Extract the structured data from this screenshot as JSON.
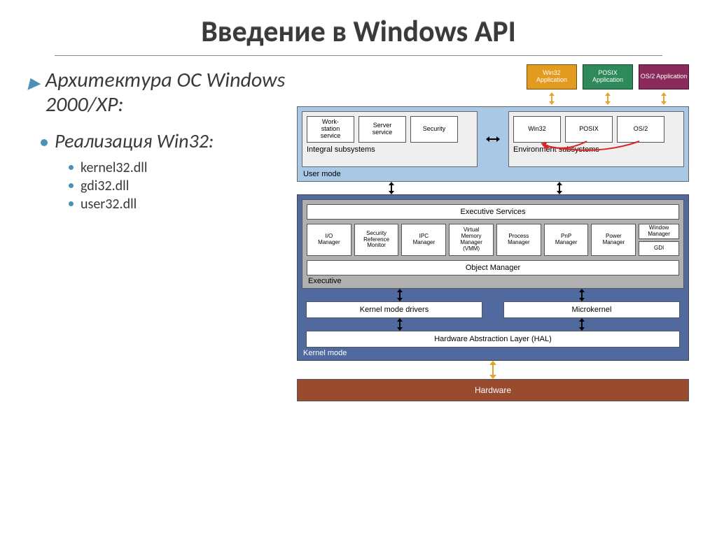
{
  "title": "Введение в Windows API",
  "bullets": {
    "lvl1": "Архитектура  ОС Windows 2000/XP:",
    "lvl2": "Реализация Win32:",
    "lvl3": [
      "kernel32.dll",
      "gdi32.dll",
      "user32.dll"
    ]
  },
  "diagram": {
    "apps": [
      {
        "label": "Win32 Application",
        "color": "orange"
      },
      {
        "label": "POSIX Application",
        "color": "green"
      },
      {
        "label": "OS/2 Application",
        "color": "maroon"
      }
    ],
    "user_mode_label": "User mode",
    "integral": {
      "label": "Integral subsystems",
      "boxes": [
        "Work-\nstation\nservice",
        "Server\nservice",
        "Security"
      ]
    },
    "environment": {
      "label": "Environment subsystems",
      "boxes": [
        "Win32",
        "POSIX",
        "OS/2"
      ]
    },
    "kernel_mode_label": "Kernel mode",
    "executive": {
      "panel_label": "Executive",
      "exec_services": "Executive Services",
      "managers": [
        "I/O\nManager",
        "Security\nReference\nMonitor",
        "IPC\nManager",
        "Virtual\nMemory\nManager\n(VMM)",
        "Process\nManager",
        "PnP\nManager",
        "Power\nManager"
      ],
      "side_stack": [
        "Window\nManager",
        "GDI"
      ],
      "object_manager": "Object Manager"
    },
    "drivers": "Kernel mode drivers",
    "microkernel": "Microkernel",
    "hal": "Hardware Abstraction Layer (HAL)",
    "hardware": "Hardware"
  }
}
